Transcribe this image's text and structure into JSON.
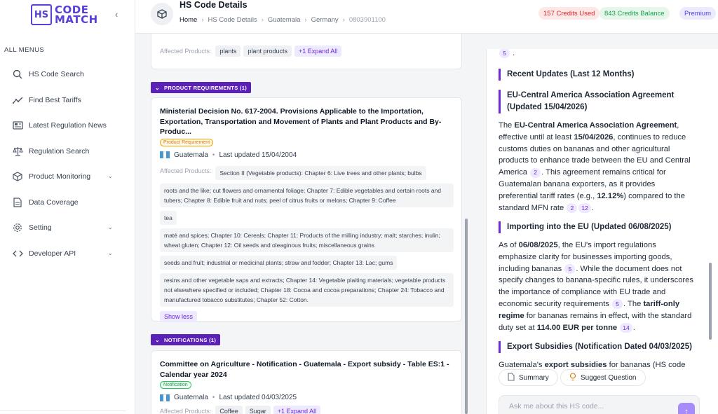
{
  "app": {
    "logo_mark": "HS",
    "logo_line1": "CODE",
    "logo_line2": "MATCH",
    "collapse_icon": "chevron-left-icon"
  },
  "sidebar": {
    "heading": "ALL MENUS",
    "items": [
      {
        "label": "HS Code Search",
        "icon": "search-icon"
      },
      {
        "label": "Find Best Tariffs",
        "icon": "trend-icon"
      },
      {
        "label": "Latest Regulation News",
        "icon": "news-icon"
      },
      {
        "label": "Regulation Search",
        "icon": "scale-icon"
      },
      {
        "label": "Product Monitoring",
        "icon": "box-icon",
        "has_chevron": true
      },
      {
        "label": "Data Coverage",
        "icon": "document-icon"
      },
      {
        "label": "Setting",
        "icon": "gear-icon",
        "has_chevron": true
      },
      {
        "label": "Developer API",
        "icon": "code-icon",
        "has_chevron": true
      }
    ]
  },
  "header": {
    "title": "HS Code Details",
    "breadcrumbs": [
      "Home",
      "HS Code Details",
      "Guatemala",
      "Germany",
      "0803901100"
    ],
    "credits_used": "157 Credits Used",
    "credits_balance": "843 Credits Balance",
    "plan": "Premium"
  },
  "top_card": {
    "affected_label": "Affected Products:",
    "tags": [
      "plants",
      "plant products"
    ],
    "expand": "+1 Expand All"
  },
  "product_requirements": {
    "section_label": "PRODUCT REQUIREMENTS (1)",
    "title": "Ministerial Decision No. 617-2004. Provisions Applicable to the Importation, Exportation, Transportation and Movement of Plants and Plant Products and By-Produc...",
    "type": "Product Requirement",
    "country": "Guatemala",
    "updated": "Last updated 15/04/2004",
    "affected_label": "Affected Products:",
    "products": [
      "Section II (Vegetable products): Chapter 6: Live trees and other plants; bulbs",
      "roots and the like; cut flowers and ornamental foliage; Chapter 7: Edible vegetables and certain roots and tubers; Chapter 8: Edible fruit and nuts; peel of citrus fruits or melons; Chapter 9: Coffee",
      "tea",
      "maté and spices; Chapter 10: Cereals; Chapter 11: Products of the milling industry; malt; starches; inulin; wheat gluten; Chapter 12: Oil seeds and oleaginous fruits; miscellaneous grains",
      "seeds and fruit; industrial or medicinal plants; straw and fodder; Chapter 13: Lac; gums",
      "resins and other vegetable saps and extracts; Chapter 14: Vegetable plaiting materials; vegetable products not elsewhere specified or included; Chapter 18: Cocoa and cocoa preparations; Chapter 24: Tobacco and manufactured tobacco substitutes; Chapter 52: Cotton."
    ],
    "show_less": "Show less"
  },
  "notifications": {
    "section_label": "NOTIFICATIONS (1)",
    "title": "Committee on Agriculture - Notification - Guatemala - Export subsidy - Table ES:1 - Calendar year 2024",
    "type": "Notification",
    "country": "Guatemala",
    "updated": "Last updated 04/03/2025",
    "affected_label": "Affected Products:",
    "tags": [
      "Coffee",
      "Sugar"
    ],
    "expand": "+1 Expand All"
  },
  "flag_colors": [
    "#4997d0",
    "#ffffff",
    "#4997d0"
  ],
  "right_panel": {
    "top_cite": "5",
    "recent_heading": "Recent Updates (Last 12 Months)",
    "eu_heading": "EU-Central America Association Agreement (Updated 15/04/2026)",
    "eu_para": {
      "t1": "The ",
      "b1": "EU-Central America Association Agreement",
      "t2": ", effective until at least ",
      "b2": "15/04/2026",
      "t3": ", continues to reduce customs duties on bananas and other agricultural products to enhance trade between the EU and Central America ",
      "c1": "2",
      "t4": ". This agreement remains critical for Guatemalan banana exporters, as it provides preferential tariff rates (e.g., ",
      "b3": "12.12%",
      "t5": ") compared to the standard MFN rate ",
      "c2": "2",
      "c3": "12",
      "t6": "."
    },
    "import_heading": "Importing into the EU (Updated 06/08/2025)",
    "import_para": {
      "t1": "As of ",
      "b1": "06/08/2025",
      "t2": ", the EU's import regulations emphasize clarity for businesses importing goods, including bananas ",
      "c1": "5",
      "t3": ". While the document does not specify changes to banana-specific rules, it underscores the importance of compliance with EU trade and economic security requirements ",
      "c2": "5",
      "t4": ". The ",
      "b2": "tariff-only regime",
      "t5": " for bananas remains in effect, with the standard duty set at ",
      "b3": "114.00 EUR per tonne",
      "c3": "14",
      "t6": "."
    },
    "export_heading": "Export Subsidies (Notification Dated 04/03/2025)",
    "export_para": {
      "t1": "Guatemala's ",
      "b1": "export subsidies",
      "t2": " for bananas (HS code"
    },
    "summary_btn": "Summary",
    "suggest_btn": "Suggest Question",
    "chat_placeholder": "Ask me about this HS code..."
  }
}
